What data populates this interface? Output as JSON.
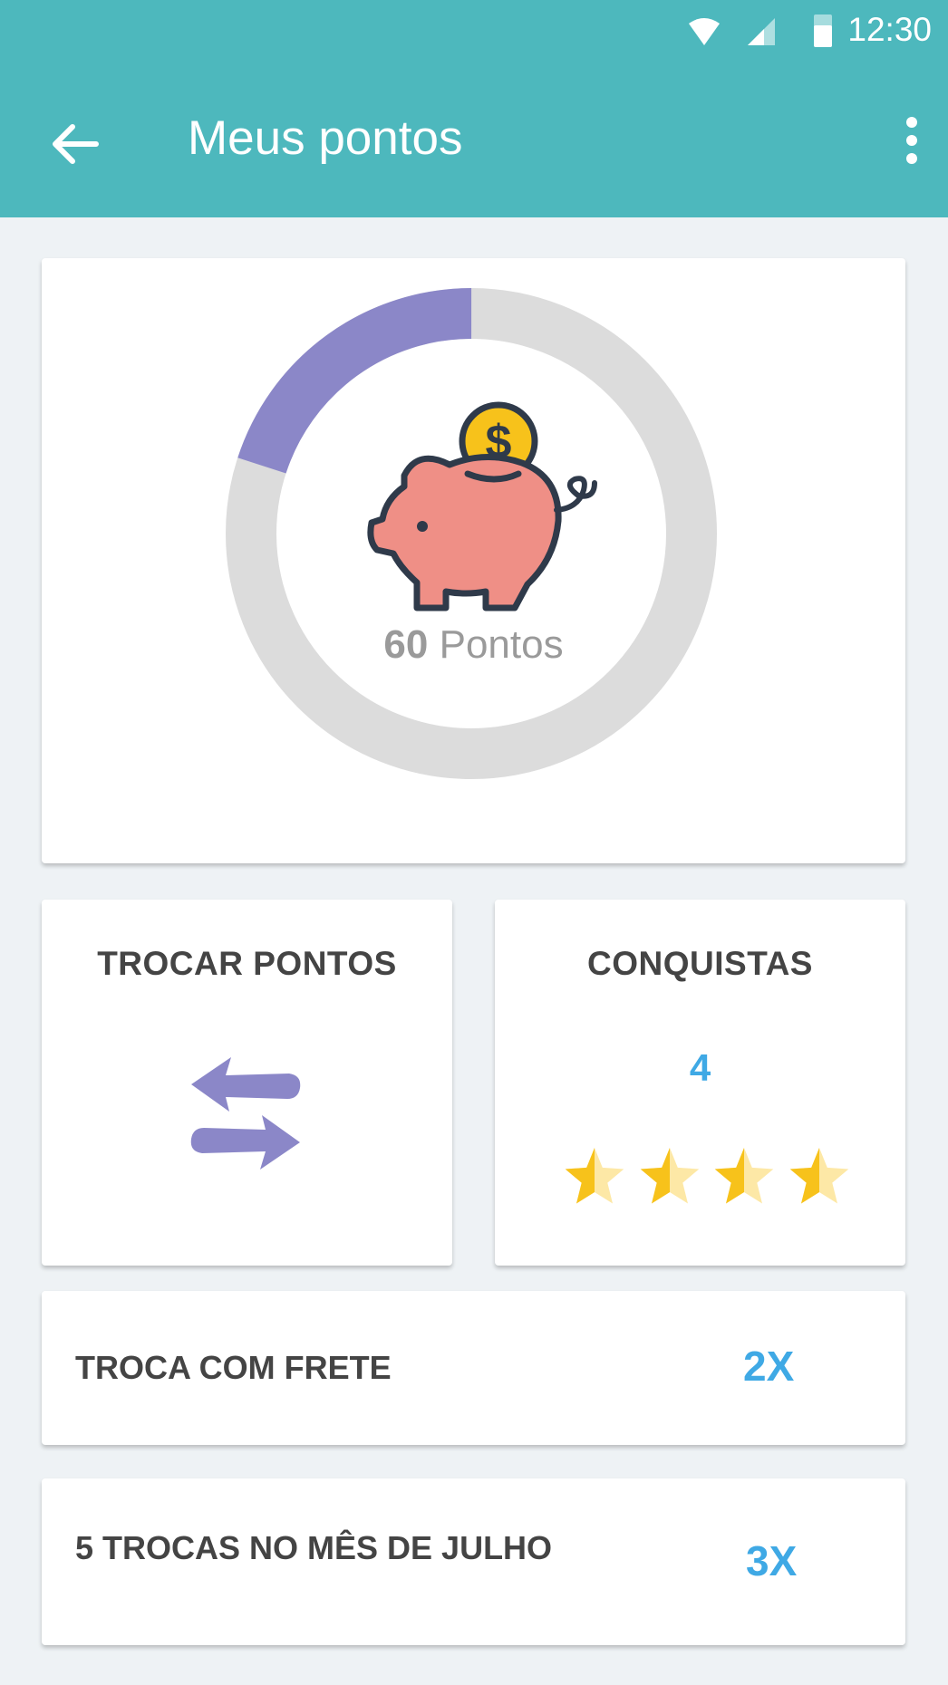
{
  "status_bar": {
    "time": "12:30"
  },
  "app_bar": {
    "title": "Meus pontos",
    "back_icon": "arrow-left-icon",
    "menu_icon": "more-vert-icon",
    "background": "#4db8bd"
  },
  "points": {
    "value": "60",
    "unit": "Pontos",
    "progress_fraction": 0.2,
    "progress_color": "#8b87c8",
    "track_color": "#dcdcdc",
    "icon": "piggy-bank-icon"
  },
  "exchange_tile": {
    "title": "TROCAR PONTOS",
    "icon": "swap-arrows-icon"
  },
  "achievements_tile": {
    "title": "CONQUISTAS",
    "count": "4",
    "stars": 4
  },
  "bonus_rows": [
    {
      "label": "TROCA COM FRETE",
      "value": "2X"
    },
    {
      "label": "5 TROCAS NO MÊS DE JULHO",
      "value": "3X"
    }
  ],
  "colors": {
    "accent": "#3fa9e5",
    "star": "#f7c21b",
    "star_light": "#fde8a6"
  }
}
